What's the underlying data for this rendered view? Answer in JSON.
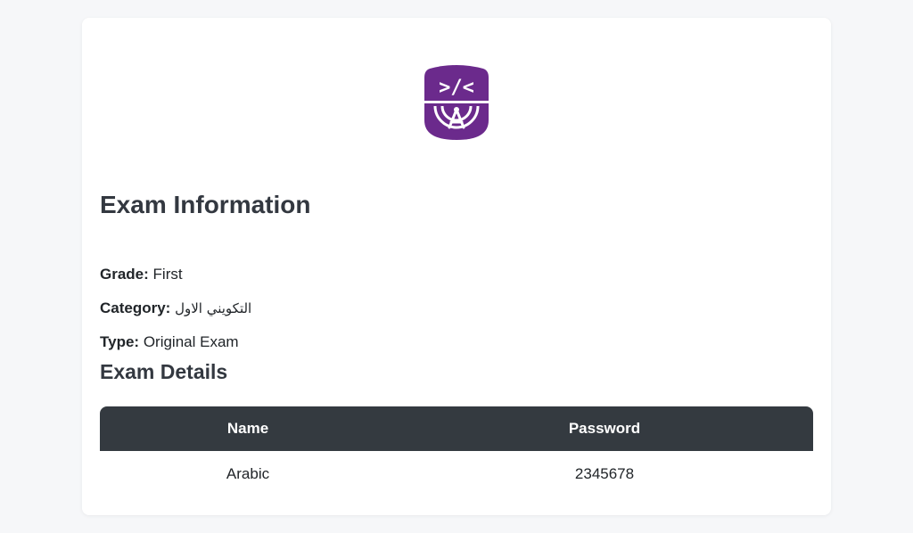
{
  "logo": {
    "icon": "code-shield-logo-icon",
    "color": "#6b2a8c",
    "glyph_text": ">/<"
  },
  "exam_info": {
    "title": "Exam Information",
    "grade_label": "Grade:",
    "grade_value": "First",
    "category_label": "Category:",
    "category_value": "التكويني الاول",
    "type_label": "Type:",
    "type_value": "Original Exam"
  },
  "exam_details": {
    "title": "Exam Details",
    "columns": [
      "Name",
      "Password"
    ],
    "rows": [
      [
        "Arabic",
        "2345678"
      ]
    ],
    "header_color": "#343a40"
  }
}
